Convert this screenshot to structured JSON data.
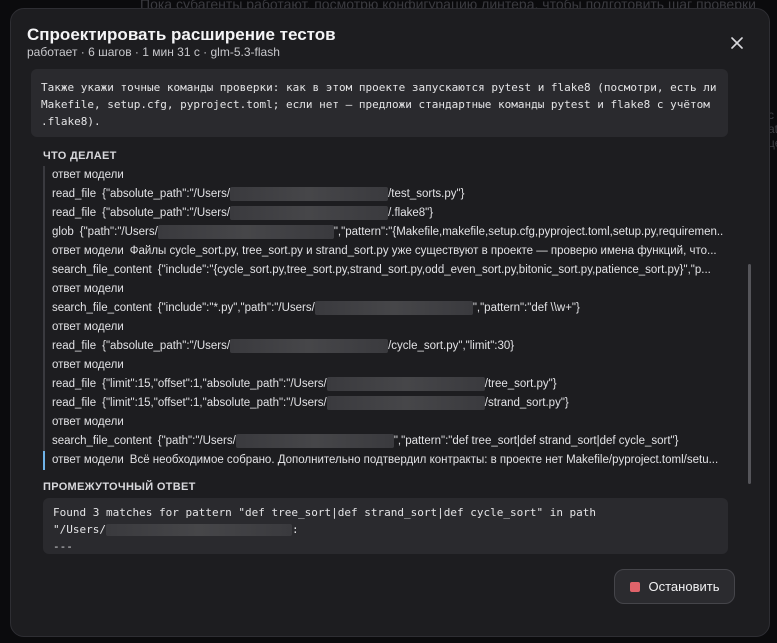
{
  "background": {
    "top_text": "Пока субагенты работают, посмотрю конфигурацию линтера, чтобы подготовить шаг проверки",
    "right_text": "с\nati\nце"
  },
  "modal": {
    "title": "Спроектировать расширение тестов",
    "subtitle": "работает · 6 шагов · 1 мин 31 с · glm-5.3-flash",
    "close_icon": "close-icon"
  },
  "prompt": {
    "text": "Также укажи точные команды проверки: как в этом проекте запускаются pytest и flake8 (посмотри, есть ли\nMakefile, setup.cfg, pyproject.toml; если нет — предложи стандартные команды pytest и flake8 с учётом\n.flake8)."
  },
  "sections": {
    "what_it_does": "ЧТО ДЕЛАЕТ",
    "intermediate_result": "ПРОМЕЖУТОЧНЫЙ ОТВЕТ"
  },
  "timeline": [
    {
      "label": "ответ модели",
      "pre": "",
      "post": "",
      "active": false
    },
    {
      "label": "read_file",
      "pre": "{\"absolute_path\":\"/Users/",
      "post": "/test_sorts.py\"}",
      "active": false
    },
    {
      "label": "read_file",
      "pre": "{\"absolute_path\":\"/Users/",
      "post": "/.flake8\"}",
      "active": false
    },
    {
      "label": "glob",
      "pre": "{\"path\":\"/Users/",
      "post": "\",\"pattern\":\"{Makefile,makefile,setup.cfg,pyproject.toml,setup.py,requiremen...",
      "active": false
    },
    {
      "label": "ответ модели",
      "pre": "Файлы cycle_sort.py, tree_sort.py и strand_sort.py уже существуют в проекте — проверю имена функций, что...",
      "post": "",
      "active": false
    },
    {
      "label": "search_file_content",
      "pre": "{\"include\":\"{cycle_sort.py,tree_sort.py,strand_sort.py,odd_even_sort.py,bitonic_sort.py,patience_sort.py}\",\"p...",
      "post": "",
      "active": false
    },
    {
      "label": "ответ модели",
      "pre": "",
      "post": "",
      "active": false
    },
    {
      "label": "search_file_content",
      "pre": "{\"include\":\"*.py\",\"path\":\"/Users/",
      "post": "\",\"pattern\":\"def \\\\w+\"}",
      "active": false
    },
    {
      "label": "ответ модели",
      "pre": "",
      "post": "",
      "active": false
    },
    {
      "label": "read_file",
      "pre": "{\"absolute_path\":\"/Users/",
      "post": "/cycle_sort.py\",\"limit\":30}",
      "active": false
    },
    {
      "label": "ответ модели",
      "pre": "",
      "post": "",
      "active": false
    },
    {
      "label": "read_file",
      "pre": "{\"limit\":15,\"offset\":1,\"absolute_path\":\"/Users/",
      "post": "/tree_sort.py\"}",
      "active": false
    },
    {
      "label": "read_file",
      "pre": "{\"limit\":15,\"offset\":1,\"absolute_path\":\"/Users/",
      "post": "/strand_sort.py\"}",
      "active": false
    },
    {
      "label": "ответ модели",
      "pre": "",
      "post": "",
      "active": false
    },
    {
      "label": "search_file_content",
      "pre": "{\"path\":\"/Users/",
      "post": "\",\"pattern\":\"def tree_sort|def strand_sort|def cycle_sort\"}",
      "active": false
    },
    {
      "label": "ответ модели",
      "pre": "Всё необходимое собрано. Дополнительно подтвердил контракты: в проекте нет Makefile/pyproject.toml/setu...",
      "post": "",
      "active": true
    }
  ],
  "output": {
    "line1": "Found 3 matches for pattern \"def tree_sort|def strand_sort|def cycle_sort\" in path",
    "line2_pre": "\"/Users/",
    "line2_post": ":",
    "line3": "---"
  },
  "stop_button": {
    "label": "Остановить",
    "accent": "#e0636a"
  }
}
